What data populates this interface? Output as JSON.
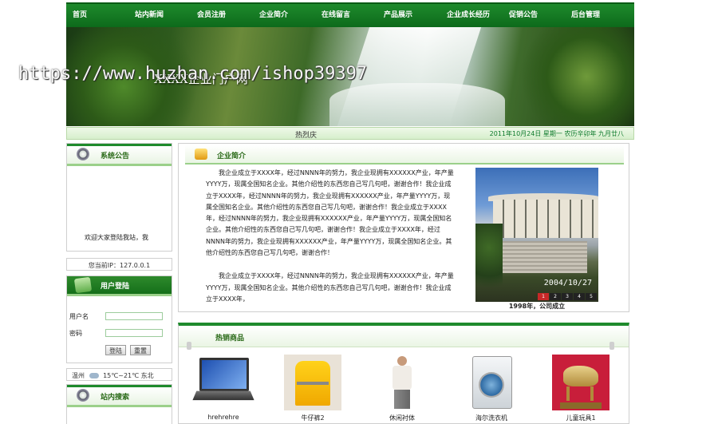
{
  "nav": [
    "首页",
    "站内新闻",
    "会员注册",
    "企业简介",
    "在线留言",
    "产品展示",
    "企业成长经历",
    "促销公告",
    "后台管理"
  ],
  "banner": {
    "site_title": "XXXX企业门户网",
    "watermark": "https://www.huzhan.com/ishop39397"
  },
  "datebar": {
    "hotline": "热烈庆",
    "date": "2011年10月24日 星期一 农历辛卯年 九月廿八"
  },
  "left": {
    "notice": {
      "title": "系统公告",
      "text": "欢迎大家登陆我站，我"
    },
    "ip": "您当前IP：127.0.0.1",
    "login": {
      "title": "用户登陆",
      "username_label": "用户名",
      "password_label": "密码",
      "login_btn": "登陆",
      "reset_btn": "重置"
    },
    "weather": {
      "city": "温州",
      "temp": "15℃~21℃",
      "wind": "东北"
    },
    "search": {
      "title": "站内搜索"
    }
  },
  "intro": {
    "title": "企业简介",
    "paragraphs": [
      "我企业成立于XXXX年，经过NNNN年的努力，我企业现拥有XXXXXX产业，年产量YYYY万，现属全国知名企业。其他介绍性的东西您自己写几句吧，谢谢合作！我企业成立于XXXX年，经过NNNN年的努力，我企业现拥有XXXXXX产业，年产量YYYY万，现属全国知名企业。其他介绍性的东西您自己写几句吧，谢谢合作！我企业成立于XXXX年，经过NNNN年的努力，我企业现拥有XXXXXX产业，年产量YYYY万，现属全国知名企业。其他介绍性的东西您自己写几句吧，谢谢合作！我企业成立于XXXX年，经过NNNN年的努力，我企业现拥有XXXXXX产业，年产量YYYY万，现属全国知名企业。其他介绍性的东西您自己写几句吧，谢谢合作！",
      "我企业成立于XXXX年，经过NNNN年的努力，我企业现拥有XXXXXX产业，年产量YYYY万，现属全国知名企业。其他介绍性的东西您自己写几句吧，谢谢合作！我企业成立于XXXX年，"
    ],
    "photo_stamp": "2004/10/27",
    "photo_dots": [
      "1",
      "2",
      "3",
      "4",
      "5"
    ],
    "caption": "1998年，公司成立"
  },
  "hot": {
    "title": "热销商品",
    "products": [
      "hrehrehre",
      "牛仔裤2",
      "休闲衬体",
      "海尔洗衣机",
      "儿童玩具1"
    ]
  }
}
